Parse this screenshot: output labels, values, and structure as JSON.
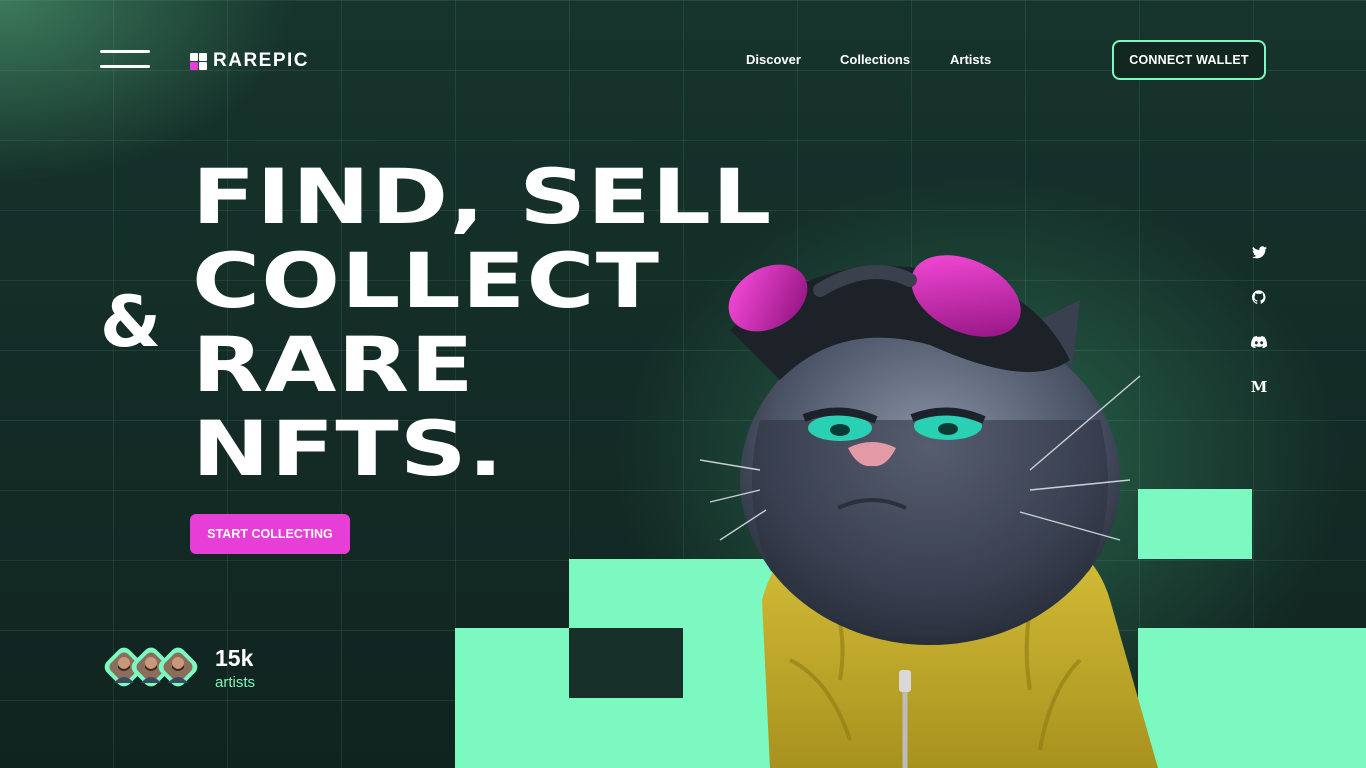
{
  "brand": {
    "name": "RAREPIC",
    "accent": "#7cf9c0",
    "pink": "#e83ed8",
    "background": "#16302a"
  },
  "nav": {
    "menu_icon": "hamburger-menu-icon",
    "items": [
      {
        "label": "Discover"
      },
      {
        "label": "Collections"
      },
      {
        "label": "Artists"
      }
    ],
    "connect_label": "CONNECT WALLET"
  },
  "hero": {
    "lines": [
      "FIND, SELL",
      "COLLECT",
      "RARE",
      "NFTS."
    ],
    "ampersand": "&",
    "cta_label": "START COLLECTING"
  },
  "stats": {
    "value": "15k",
    "label": "artists",
    "avatar_count": 3
  },
  "social": [
    {
      "name": "twitter-icon"
    },
    {
      "name": "github-icon"
    },
    {
      "name": "discord-icon"
    },
    {
      "name": "medium-icon",
      "glyph": "M"
    }
  ]
}
